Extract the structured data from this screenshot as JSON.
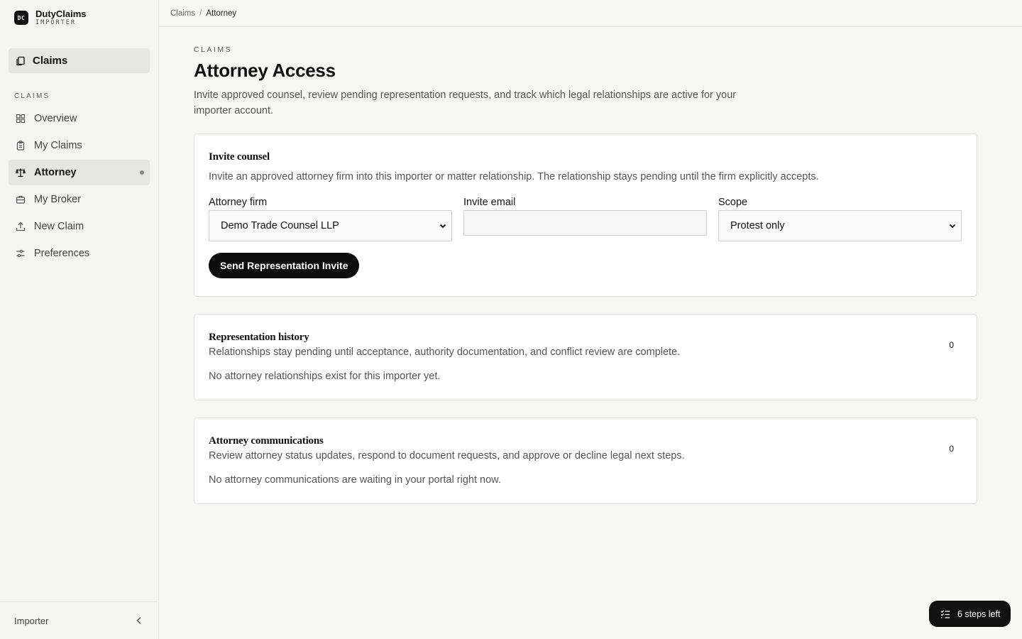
{
  "brand": {
    "logo": "DC",
    "name": "DutyClaims",
    "sub": "IMPORTER"
  },
  "sidebar": {
    "primary": {
      "label": "Claims",
      "icon": "document-copy-icon"
    },
    "section_label": "CLAIMS",
    "items": [
      {
        "label": "Overview",
        "icon": "grid-icon"
      },
      {
        "label": "My Claims",
        "icon": "clipboard-icon"
      },
      {
        "label": "Attorney",
        "icon": "scale-icon",
        "active": true
      },
      {
        "label": "My Broker",
        "icon": "briefcase-icon"
      },
      {
        "label": "New Claim",
        "icon": "upload-icon"
      },
      {
        "label": "Preferences",
        "icon": "sliders-icon"
      }
    ],
    "footer": {
      "role": "Importer",
      "collapse_icon": "chevron-left-icon"
    }
  },
  "breadcrumb": {
    "parent": "Claims",
    "separator": "/",
    "current": "Attorney"
  },
  "page": {
    "eyebrow": "CLAIMS",
    "title": "Attorney Access",
    "description": "Invite approved counsel, review pending representation requests, and track which legal relationships are active for your importer account."
  },
  "invite": {
    "title": "Invite counsel",
    "description": "Invite an approved attorney firm into this importer or matter relationship. The relationship stays pending until the firm explicitly accepts.",
    "firm_label": "Attorney firm",
    "firm_value": "Demo Trade Counsel LLP",
    "email_label": "Invite email",
    "email_value": "",
    "scope_label": "Scope",
    "scope_value": "Protest only",
    "send_label": "Send Representation Invite"
  },
  "history": {
    "title": "Representation history",
    "description": "Relationships stay pending until acceptance, authority documentation, and conflict review are complete.",
    "empty": "No attorney relationships exist for this importer yet.",
    "count": "0"
  },
  "communications": {
    "title": "Attorney communications",
    "description": "Review attorney status updates, respond to document requests, and approve or decline legal next steps.",
    "empty": "No attorney communications are waiting in your portal right now.",
    "count": "0"
  },
  "steps": {
    "label": "6 steps left",
    "icon": "checklist-icon"
  }
}
